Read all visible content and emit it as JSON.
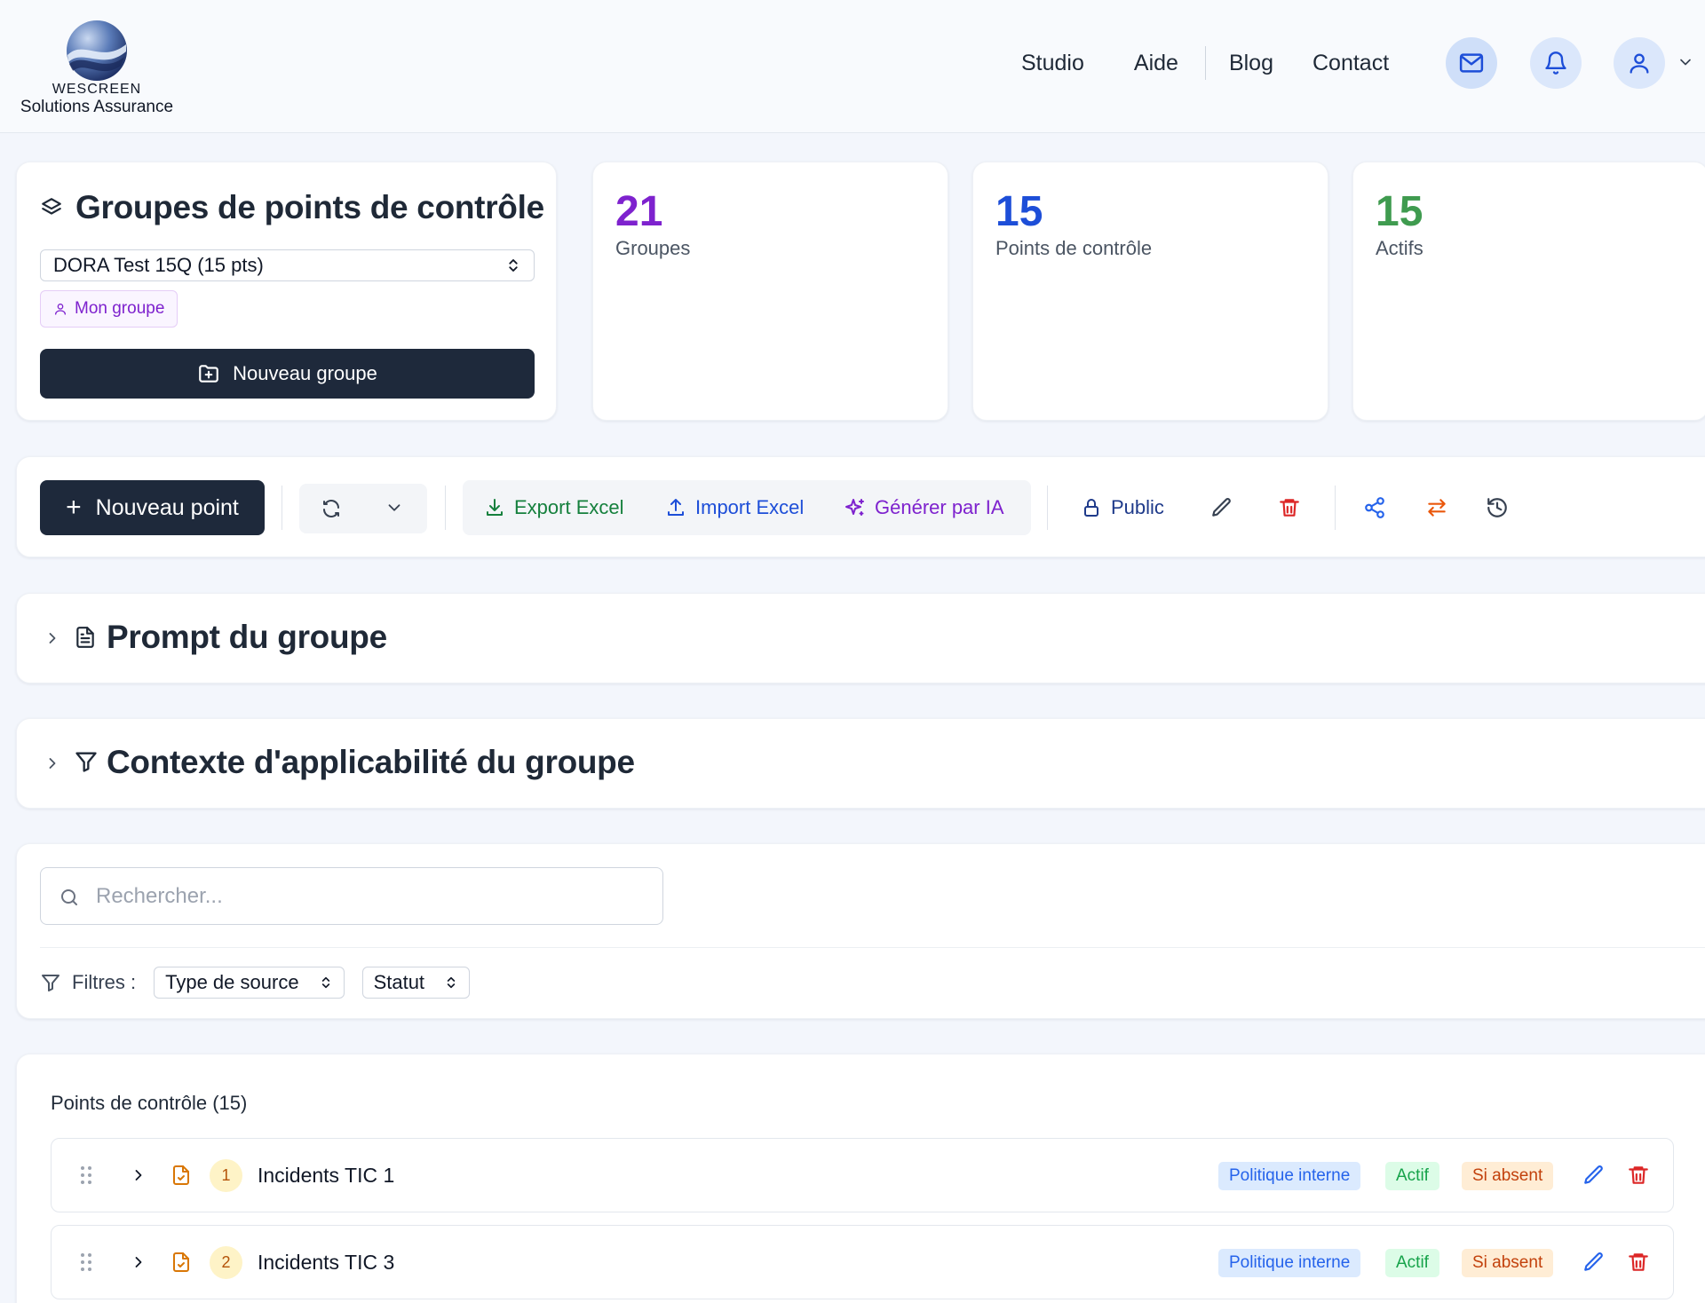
{
  "brand": {
    "name": "WESCREEN",
    "subtitle": "Solutions Assurance"
  },
  "nav": {
    "links": [
      "Studio",
      "Aide",
      "Blog",
      "Contact"
    ],
    "icons": [
      "mail-icon",
      "bell-icon",
      "user-icon",
      "chevron-down-icon"
    ]
  },
  "groups_panel": {
    "title": "Groupes de points de contrôle",
    "selected_group": "DORA Test 15Q (15 pts)",
    "owner_badge": "Mon groupe",
    "new_group_label": "Nouveau groupe"
  },
  "stats": [
    {
      "value": "21",
      "label": "Groupes",
      "color": "#7e22ce"
    },
    {
      "value": "15",
      "label": "Points de contrôle",
      "color": "#1d4ed8"
    },
    {
      "value": "15",
      "label": "Actifs",
      "color": "#3f9b4f"
    }
  ],
  "toolbar": {
    "new_point_label": "Nouveau point",
    "export_label": "Export Excel",
    "import_label": "Import Excel",
    "generate_label": "Générer par IA",
    "visibility_label": "Public",
    "colors": {
      "export": "#15803d",
      "import": "#1d4ed8",
      "generate": "#7e22ce",
      "visibility": "#1e3a8a",
      "delete": "#dc2626",
      "share": "#2563eb",
      "swap": "#ea580c"
    }
  },
  "sections": {
    "prompt_title": "Prompt du groupe",
    "context_title": "Contexte d'applicabilité du groupe"
  },
  "search": {
    "placeholder": "Rechercher...",
    "value": "",
    "filters_label": "Filtres :",
    "filter_source": "Type de source",
    "filter_status": "Statut"
  },
  "points": {
    "title": "Points de contrôle (15)",
    "rows": [
      {
        "index": "1",
        "name": "Incidents TIC 1",
        "source": "Politique interne",
        "status": "Actif",
        "rule": "Si absent"
      },
      {
        "index": "2",
        "name": "Incidents TIC 3",
        "source": "Politique interne",
        "status": "Actif",
        "rule": "Si absent"
      }
    ]
  }
}
